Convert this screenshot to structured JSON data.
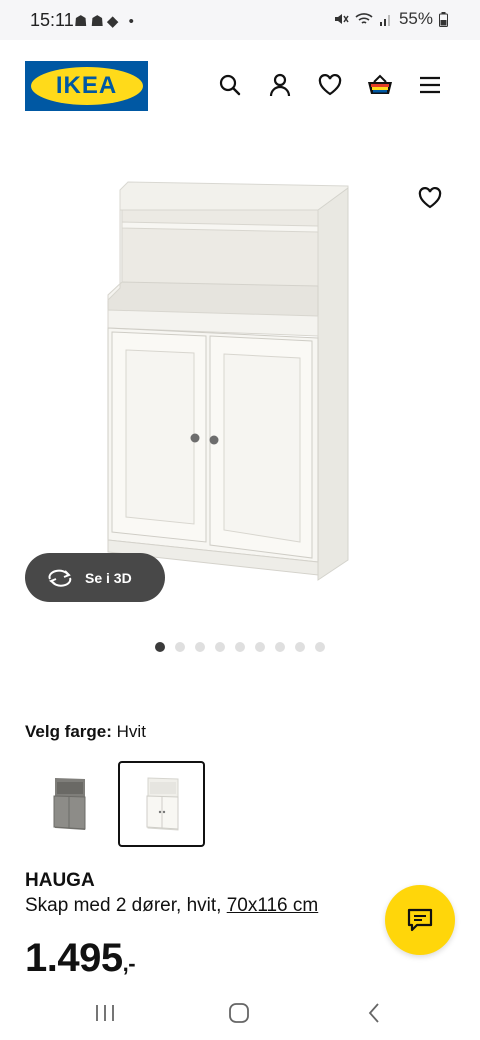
{
  "status": {
    "time": "15:11",
    "left_icons": "☗☗◆ •",
    "battery": "55%"
  },
  "header": {
    "logo": "IKEA",
    "icons": [
      "search-icon",
      "user-icon",
      "heart-icon",
      "basket-icon",
      "menu-icon"
    ]
  },
  "gallery": {
    "view3d_label": "Se i 3D",
    "image_count": 9,
    "active_index": 0
  },
  "color": {
    "label": "Velg farge:",
    "value": "Hvit",
    "options": [
      "grey",
      "white"
    ],
    "selected": 1
  },
  "product": {
    "name": "HAUGA",
    "description": "Skap med 2 dører, hvit, ",
    "dimensions": "70x116 cm",
    "price": "1.495",
    "price_suffix": ",-"
  },
  "colors": {
    "ikea_blue": "#0058a3",
    "ikea_yellow": "#ffda1a",
    "chat_yellow": "#ffd60a"
  }
}
